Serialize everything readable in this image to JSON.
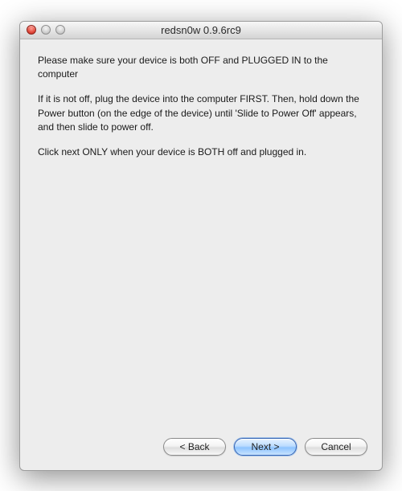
{
  "window": {
    "title": "redsn0w 0.9.6rc9"
  },
  "content": {
    "p1": "Please make sure your device is both OFF and PLUGGED IN to the computer",
    "p2": "If it is not off, plug the device into the computer FIRST. Then, hold down the Power button (on the edge of the device) until 'Slide to Power Off' appears, and then slide to power off.",
    "p3": "Click next ONLY when your device is BOTH off and plugged in."
  },
  "buttons": {
    "back": "< Back",
    "next": "Next >",
    "cancel": "Cancel"
  }
}
